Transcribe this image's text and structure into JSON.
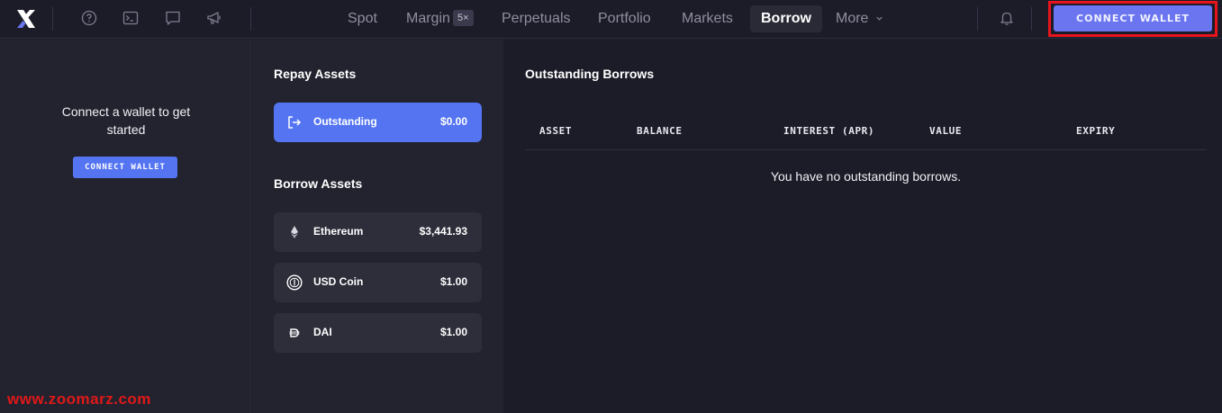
{
  "nav": {
    "items": [
      {
        "label": "Spot"
      },
      {
        "label": "Margin"
      },
      {
        "label": "Perpetuals"
      },
      {
        "label": "Portfolio"
      },
      {
        "label": "Markets"
      },
      {
        "label": "Borrow"
      },
      {
        "label": "More"
      }
    ],
    "margin_badge": "5×",
    "connect_wallet": "CONNECT WALLET",
    "icons": [
      "help-icon",
      "terminal-icon",
      "chat-icon",
      "megaphone-icon",
      "bell-icon"
    ]
  },
  "left": {
    "message": "Connect a wallet to get started",
    "button": "CONNECT WALLET",
    "watermark": "www.zoomarz.com"
  },
  "repay": {
    "title": "Repay Assets",
    "item": {
      "name": "Outstanding",
      "value": "$0.00",
      "icon": "exit-icon"
    }
  },
  "borrow": {
    "title": "Borrow Assets",
    "items": [
      {
        "name": "Ethereum",
        "value": "$3,441.93",
        "icon": "ethereum-icon"
      },
      {
        "name": "USD Coin",
        "value": "$1.00",
        "icon": "usdc-icon"
      },
      {
        "name": "DAI",
        "value": "$1.00",
        "icon": "dai-icon"
      }
    ]
  },
  "outstanding": {
    "title": "Outstanding Borrows",
    "columns": [
      "ASSET",
      "BALANCE",
      "INTEREST (APR)",
      "VALUE",
      "EXPIRY"
    ],
    "empty": "You have no outstanding borrows."
  },
  "colors": {
    "accent": "#5474f2",
    "highlight": "#e8141c",
    "background": "#1c1c28",
    "panel": "#23232f"
  }
}
